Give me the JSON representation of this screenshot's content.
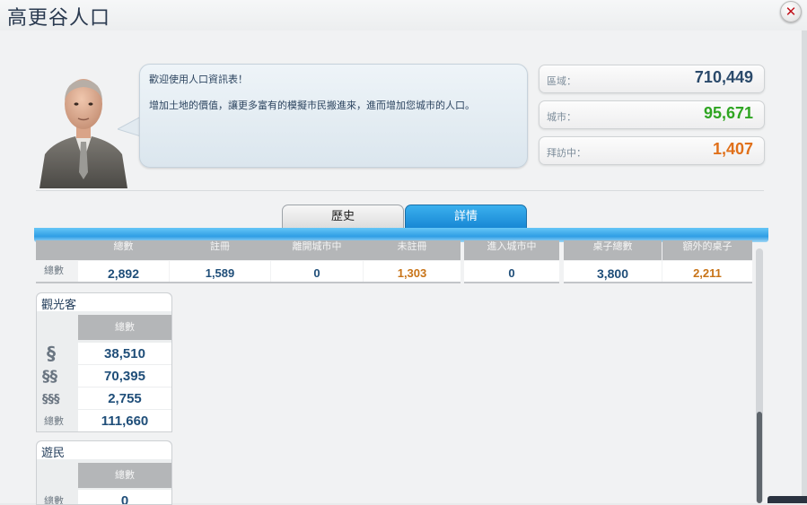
{
  "window": {
    "title": "高更谷人口",
    "close_glyph": "✕"
  },
  "advisor": {
    "greeting": "歡迎使用人口資訊表！",
    "message": "增加土地的價值，讓更多富有的模擬市民搬進來，進而增加您城市的人口。"
  },
  "stats": [
    {
      "label": "區域：",
      "value": "710,449",
      "color": "#2b4a6b"
    },
    {
      "label": "城市：",
      "value": "95,671",
      "color": "#2fa522"
    },
    {
      "label": "拜訪中：",
      "value": "1,407",
      "color": "#e0701a"
    }
  ],
  "tabs": {
    "history": "歷史",
    "details": "詳情"
  },
  "residents": {
    "headers": [
      "總數",
      "註冊",
      "離開城市中",
      "未註冊",
      "進入城市中",
      "桌子總數",
      "額外的桌子"
    ],
    "row_label": "總數",
    "values": [
      "2,892",
      "1,589",
      "0",
      "1,303",
      "0",
      "3,800",
      "2,211"
    ],
    "value_colors": [
      "#1f4e79",
      "#1f4e79",
      "#1f4e79",
      "#c87418",
      "#1f4e79",
      "#1f4e79",
      "#c87418"
    ]
  },
  "tourists": {
    "title": "觀光客",
    "header": "總數",
    "rows": [
      {
        "icon": "single-star-icon",
        "value": "38,510"
      },
      {
        "icon": "double-star-icon",
        "value": "70,395"
      },
      {
        "icon": "triple-star-icon",
        "value": "2,755"
      },
      {
        "label": "總數",
        "value": "111,660"
      }
    ]
  },
  "nomads": {
    "title": "遊民",
    "header": "總數",
    "row_label": "總數",
    "value": "0"
  }
}
